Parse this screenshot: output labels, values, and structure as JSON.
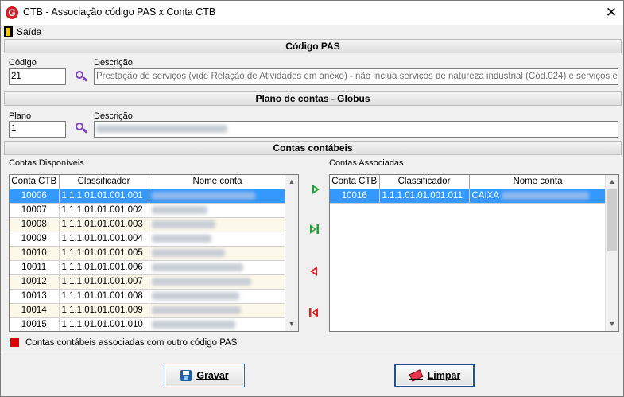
{
  "window": {
    "title": "CTB - Associação código PAS x Conta CTB",
    "logo_letter": "G"
  },
  "menu": {
    "exit_label": "Saída"
  },
  "codigo_pas": {
    "section_title": "Código PAS",
    "code_label": "Código",
    "code_value": "21",
    "desc_label": "Descrição",
    "desc_value": "Prestação de serviços (vide Relação de Atividades em anexo) - não inclua serviços de natureza industrial (Cód.024) e serviços especializ"
  },
  "plano_contas": {
    "section_title": "Plano de contas - Globus",
    "plan_label": "Plano",
    "plan_value": "1",
    "desc_label": "Descrição"
  },
  "contas": {
    "section_title": "Contas contábeis",
    "available_title": "Contas Disponíveis",
    "associated_title": "Contas Associadas",
    "columns": [
      "Conta CTB",
      "Classificador",
      "Nome conta"
    ],
    "available_rows": [
      {
        "conta": "10006",
        "classificador": "1.1.1.01.01.001.001"
      },
      {
        "conta": "10007",
        "classificador": "1.1.1.01.01.001.002"
      },
      {
        "conta": "10008",
        "classificador": "1.1.1.01.01.001.003"
      },
      {
        "conta": "10009",
        "classificador": "1.1.1.01.01.001.004"
      },
      {
        "conta": "10010",
        "classificador": "1.1.1.01.01.001.005"
      },
      {
        "conta": "10011",
        "classificador": "1.1.1.01.01.001.006"
      },
      {
        "conta": "10012",
        "classificador": "1.1.1.01.01.001.007"
      },
      {
        "conta": "10013",
        "classificador": "1.1.1.01.01.001.008"
      },
      {
        "conta": "10014",
        "classificador": "1.1.1.01.01.001.009"
      },
      {
        "conta": "10015",
        "classificador": "1.1.1.01.01.001.010"
      }
    ],
    "associated_rows": [
      {
        "conta": "10016",
        "classificador": "1.1.1.01.01.001.011",
        "nome": "CAIXA"
      }
    ],
    "legend": "Contas contábeis associadas com outro código PAS"
  },
  "buttons": {
    "save_label": "Gravar",
    "clear_label": "Limpar"
  },
  "colors": {
    "selection": "#3399ff",
    "legend_red": "#e00000",
    "arrow_green": "#17a832",
    "arrow_red": "#e02020"
  }
}
